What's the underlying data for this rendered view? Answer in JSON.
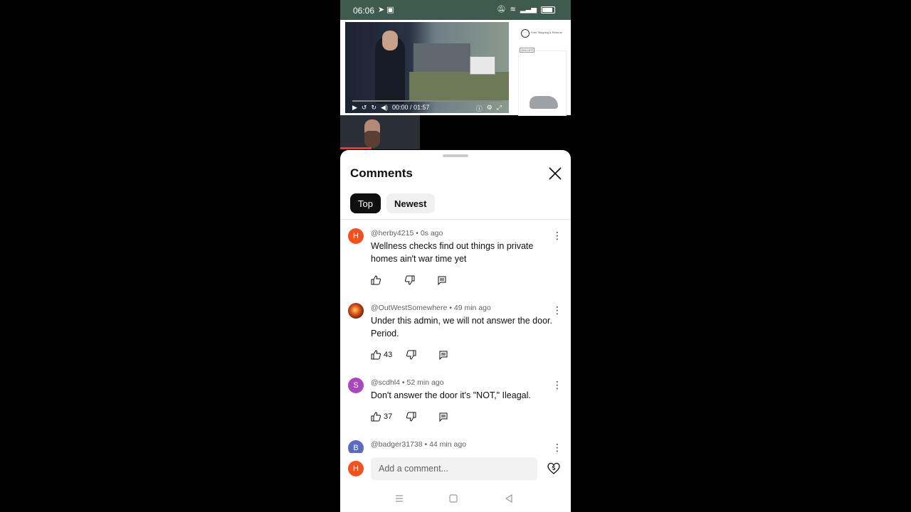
{
  "status_bar": {
    "time": "06:06",
    "left_icons": [
      "telegram-icon",
      "camera-icon"
    ],
    "right_icons": [
      "mute-icon",
      "wifi-icon",
      "signal-icon",
      "battery-icon"
    ]
  },
  "video": {
    "time_display": "00:00 / 01:57",
    "ad_text": "Free Shipping & Returns",
    "ad_badge": "25% OFF"
  },
  "comments_panel": {
    "title": "Comments",
    "tabs": [
      {
        "label": "Top",
        "active": true
      },
      {
        "label": "Newest",
        "active": false
      }
    ],
    "comments": [
      {
        "initial": "H",
        "avatar_color": "#f4511e",
        "author": "@herby4215",
        "time": "0s ago",
        "text": "Wellness checks find out things in private homes ain't war time yet",
        "likes": ""
      },
      {
        "initial": "",
        "avatar_color": "#b33a1a",
        "author": "@OutWestSomewhere",
        "time": "49 min ago",
        "text": "Under this admin, we will not answer the door. Period.",
        "likes": "43"
      },
      {
        "initial": "S",
        "avatar_color": "#ab47bc",
        "author": "@scdhl4",
        "time": "52 min ago",
        "text": "Don't answer the door it's \"NOT,\" Ileagal.",
        "likes": "37"
      },
      {
        "initial": "B",
        "avatar_color": "#5c6bc0",
        "author": "@badger31738",
        "time": "44 min ago",
        "text": "",
        "likes": ""
      }
    ],
    "composer": {
      "initial": "H",
      "placeholder": "Add a comment..."
    }
  },
  "nav_bar": [
    "menu-icon",
    "home-square-icon",
    "back-triangle-icon"
  ]
}
